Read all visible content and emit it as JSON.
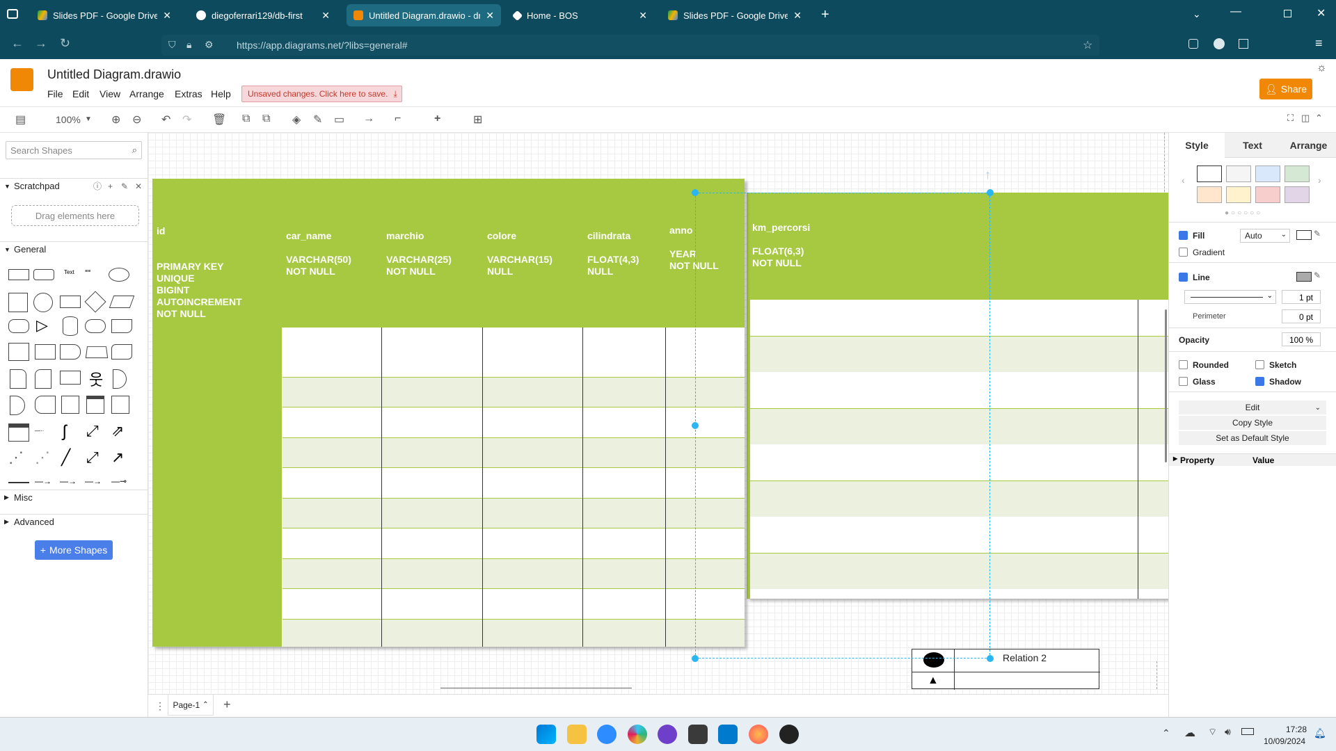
{
  "browser": {
    "tabs": [
      {
        "label": "Slides PDF - Google Drive",
        "active": false
      },
      {
        "label": "diegoferrari129/db-first",
        "active": false
      },
      {
        "label": "Untitled Diagram.drawio - draw",
        "active": true
      },
      {
        "label": "Home - BOS",
        "active": false
      },
      {
        "label": "Slides PDF - Google Drive",
        "active": false
      }
    ],
    "url": "https://app.diagrams.net/?libs=general#"
  },
  "app": {
    "title": "Untitled Diagram.drawio",
    "menus": [
      "File",
      "Edit",
      "View",
      "Arrange",
      "Extras",
      "Help"
    ],
    "unsaved": "Unsaved changes. Click here to save.",
    "share": "Share"
  },
  "toolbar": {
    "zoom": "100%"
  },
  "left_panel": {
    "search_placeholder": "Search Shapes",
    "scratchpad": "Scratchpad",
    "drag_hint": "Drag elements here",
    "general": "General",
    "misc": "Misc",
    "advanced": "Advanced",
    "more_shapes": "More Shapes"
  },
  "diagram": {
    "table1_columns": [
      {
        "name": "id",
        "desc": "PRIMARY KEY\nUNIQUE\nBIGINT\nAUTOINCREMENT\nNOT NULL"
      },
      {
        "name": "car_name",
        "desc": "VARCHAR(50)\nNOT NULL"
      },
      {
        "name": "marchio",
        "desc": "VARCHAR(25)\nNOT NULL"
      },
      {
        "name": "colore",
        "desc": "VARCHAR(15)\nNULL"
      },
      {
        "name": "cilindrata",
        "desc": "FLOAT(4,3)\nNULL"
      },
      {
        "name": "anno",
        "desc": "YEAR\nNOT NULL"
      }
    ],
    "table2_columns": [
      {
        "name": "km_percorsi",
        "desc": "FLOAT(6,3)\nNOT NULL"
      }
    ],
    "relation_label": "Relation 2"
  },
  "right_panel": {
    "tabs": [
      "Style",
      "Text",
      "Arrange"
    ],
    "fill": "Fill",
    "fill_value": "Auto",
    "gradient": "Gradient",
    "line": "Line",
    "line_width": "1 pt",
    "perimeter": "Perimeter",
    "perimeter_value": "0 pt",
    "opacity": "Opacity",
    "opacity_value": "100 %",
    "rounded": "Rounded",
    "sketch": "Sketch",
    "glass": "Glass",
    "shadow": "Shadow",
    "edit": "Edit",
    "copy_style": "Copy Style",
    "default_style": "Set as Default Style",
    "property": "Property",
    "value": "Value",
    "swatches": [
      "#ffffff",
      "#f5f5f5",
      "#dae8fc",
      "#d5e8d4",
      "#ffe6cc",
      "#fff2cc",
      "#f8cecc",
      "#e1d5e7"
    ]
  },
  "page_bar": {
    "page": "Page-1"
  },
  "taskbar": {
    "time": "17:28",
    "date": "10/09/2024"
  }
}
